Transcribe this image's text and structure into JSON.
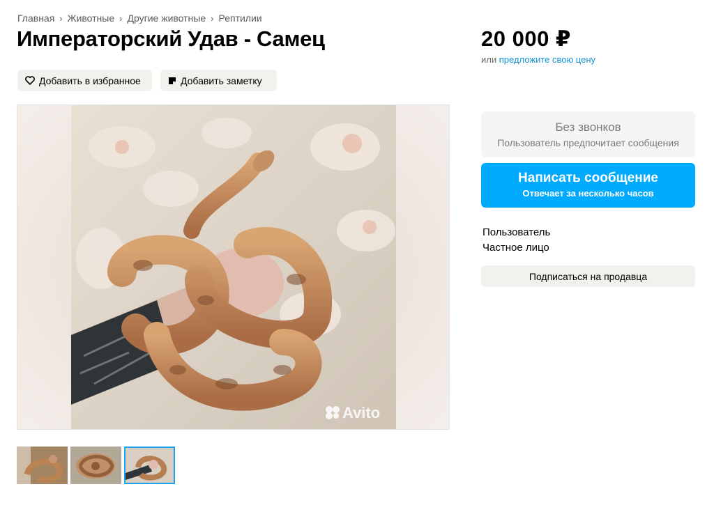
{
  "breadcrumb": [
    "Главная",
    "Животные",
    "Другие животные",
    "Рептилии"
  ],
  "title": "Императорский Удав - Самец",
  "actions": {
    "favorite": "Добавить в избранное",
    "note": "Добавить заметку"
  },
  "price": {
    "value": "20 000 ₽",
    "offer_prefix": "или",
    "offer_link": "предложите свою цену"
  },
  "contact": {
    "no_calls_title": "Без звонков",
    "no_calls_sub": "Пользователь предпочитает сообщения",
    "message_title": "Написать сообщение",
    "message_sub": "Отвечает за несколько часов"
  },
  "seller": {
    "name": "Пользователь",
    "type": "Частное лицо",
    "subscribe": "Подписаться на продавца"
  },
  "photo": {
    "watermark": "Avito"
  },
  "icons": {
    "favorite": "heart-outline-icon",
    "note": "note-icon",
    "breadcrumb_separator": "chevron-right-icon"
  },
  "colors": {
    "accent": "#00aaff",
    "link": "#1492d6",
    "button_bg": "#f2f1ed",
    "thumb_active": "#1aa3ef"
  }
}
